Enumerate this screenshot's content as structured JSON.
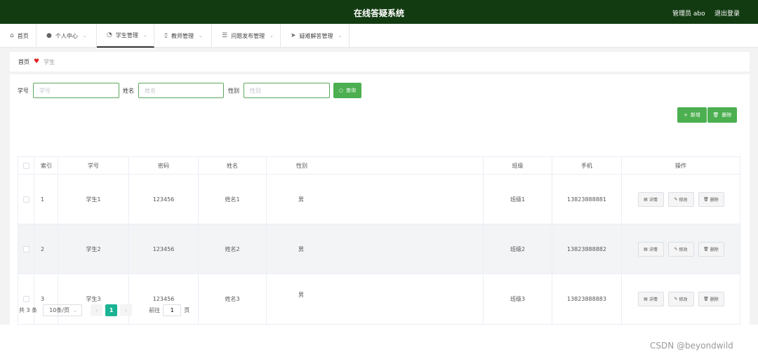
{
  "header": {
    "title": "在线答疑系统",
    "admin_label": "管理员 abo",
    "logout_label": "退出登录"
  },
  "nav": {
    "items": [
      {
        "label": "首页",
        "icon": "home-icon",
        "glyph": "⌂"
      },
      {
        "label": "个人中心",
        "icon": "user-icon",
        "glyph": "●"
      },
      {
        "label": "学生管理",
        "icon": "gauge-icon",
        "glyph": "◔"
      },
      {
        "label": "教师管理",
        "icon": "phone-icon",
        "glyph": "▯"
      },
      {
        "label": "问题发布管理",
        "icon": "list-icon",
        "glyph": "☰"
      },
      {
        "label": "疑难解答管理",
        "icon": "send-icon",
        "glyph": "➤"
      }
    ]
  },
  "breadcrumb": {
    "home": "首页",
    "current": "学生"
  },
  "search": {
    "fields": [
      {
        "label": "学号",
        "placeholder": "学号",
        "value": ""
      },
      {
        "label": "姓名",
        "placeholder": "姓名",
        "value": ""
      },
      {
        "label": "性别",
        "placeholder": "性别",
        "value": ""
      }
    ],
    "button": "查询"
  },
  "actions": {
    "add": "新增",
    "delete": "删除"
  },
  "table": {
    "columns": [
      "索引",
      "学号",
      "密码",
      "姓名",
      "性别",
      "班级",
      "手机",
      "操作"
    ],
    "rows": [
      {
        "index": "1",
        "student_id": "学生1",
        "password": "123456",
        "name": "姓名1",
        "gender": "男",
        "class": "班级1",
        "phone": "13823888881"
      },
      {
        "index": "2",
        "student_id": "学生2",
        "password": "123456",
        "name": "姓名2",
        "gender": "男",
        "class": "班级2",
        "phone": "13823888882"
      },
      {
        "index": "3",
        "student_id": "学生3",
        "password": "123456",
        "name": "姓名3",
        "gender": "男",
        "class": "班级3",
        "phone": "13823888883"
      }
    ],
    "row_actions": {
      "detail": "详情",
      "edit": "修改",
      "delete": "删除"
    }
  },
  "pagination": {
    "total": "共 3 条",
    "page_size": "10条/页",
    "current_page": "1",
    "goto_label": "前往",
    "goto_value": "1",
    "page_suffix": "页"
  },
  "watermark": "CSDN @beyondwild"
}
